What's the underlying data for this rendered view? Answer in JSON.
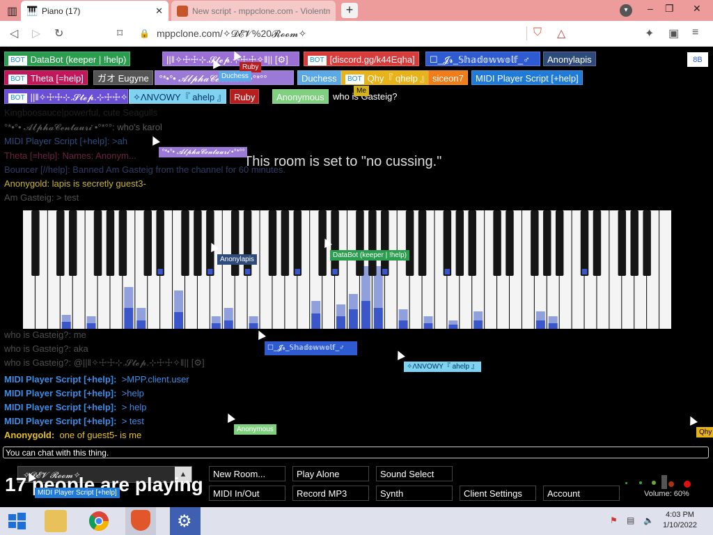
{
  "browser": {
    "tabs": [
      {
        "title": "Piano (17)",
        "active": true
      },
      {
        "title": "New script - mppclone.com - Violentmo",
        "active": false
      }
    ],
    "url": "mppclone.com/✧𝓓𝓔𝓥%20𝓡𝓸𝓸𝓶✧",
    "new_tab": "+",
    "window_controls": [
      "–",
      "❐",
      "✕"
    ]
  },
  "participants": [
    {
      "label": "DataBot (keeper | !help)",
      "bot": true,
      "color": "#2a9d4f"
    },
    {
      "label": "||‖✧☩☩⊹.𝓢𝓽𝓮𝓹.⊹☩☩✧‖|| [⚙]",
      "bot": false,
      "color": "#9a6fd6"
    },
    {
      "label": "[discord.gg/k44Eqha]",
      "bot": true,
      "color": "#d93b3b"
    },
    {
      "label": "☐_𝓙𝓻_𝕊𝕙𝕒𝕕𝕠𝕨𝕨𝕠𝕝𝕗_♂",
      "bot": false,
      "color": "#2e5bd1"
    },
    {
      "label": "Anonylapis",
      "bot": false,
      "color": "#2e4a7a"
    },
    {
      "label": "Theta [=help]",
      "bot": true,
      "color": "#c2185b"
    },
    {
      "label": "ガオ Eugyne",
      "bot": false,
      "color": "#555555"
    },
    {
      "label": "°*•°• 𝓐𝓵𝓹𝓱𝓪𝓒𝓮𝓷𝓽𝓪𝓾𝓻𝓲 •°*°°",
      "bot": false,
      "color": "#9a7ad6"
    },
    {
      "label": "Duchess",
      "bot": false,
      "color": "#5aa9e6"
    },
    {
      "label": "Qhy『 qhelp 』",
      "bot": true,
      "color": "#e8b21a"
    },
    {
      "label": "siceon7",
      "bot": false,
      "color": "#f07d1a"
    },
    {
      "label": "MIDI Player Script [+help]",
      "bot": false,
      "color": "#1f7ad8"
    },
    {
      "label": "||‖✧☩☩⊹.𝓢𝓽𝓮𝓹.⊹☩☩✧‖|| [⚙]",
      "bot": true,
      "color": "#6b4fd6"
    },
    {
      "label": "✧ΛNVOWY『 ahelp 』",
      "bot": false,
      "color": "#7fd3f0"
    },
    {
      "label": "Ruby",
      "bot": false,
      "color": "#b81e1e"
    },
    {
      "label": "Anonymous",
      "bot": false,
      "color": "#7fd07f"
    }
  ],
  "player_count_badge": "8B",
  "typing_text": "who is Gasteig?",
  "notice": "This room is set to \"no cussing.\"",
  "faded_messages": [
    "Kingboosauce|powerful, cute Seagulls",
    "°*•°• 𝓐𝓵𝓹𝓱𝓪𝓒𝓮𝓷𝓽𝓪𝓾𝓻𝓲 •°*°°: who's karol",
    "MIDI Player Script [+help]: >ah",
    "Theta [=help]: Names: Anonym...",
    "Bouncer [//help]: Banned Am Gasteig from the channel for 60 minutes.",
    "Anonygold: lapis is secretly guest3-",
    "Am Gasteig: > test",
    "who is Gasteig?: me",
    "who is Gasteig?: aka",
    "who is Gasteig?: @||‖✧☩☩⊹.𝓢𝓽𝓮𝓹.⊹☩☩✧‖|| [⚙]"
  ],
  "chat": [
    {
      "name": "MIDI Player Script [+help]:",
      "text": ">MPP.client.user",
      "color": "#3b8fe8"
    },
    {
      "name": "MIDI Player Script [+help]:",
      "text": ">help",
      "color": "#3b8fe8"
    },
    {
      "name": "MIDI Player Script [+help]:",
      "text": "> help",
      "color": "#3b8fe8"
    },
    {
      "name": "MIDI Player Script [+help]:",
      "text": "> test",
      "color": "#3b8fe8"
    },
    {
      "name": "Anonygold:",
      "text": "one of guest5- is me",
      "color": "#e8c21a"
    }
  ],
  "chat_placeholder": "You can chat with this thing.",
  "cursors": [
    {
      "label": "Ruby",
      "color": "#b81e1e"
    },
    {
      "label": "Duchess",
      "color": "#5aa9e6"
    },
    {
      "label": "Me",
      "color": "#d4b21a"
    },
    {
      "label": "°*•°• 𝓐𝓵𝓹𝓱𝓪𝓒𝓮𝓷𝓽𝓪𝓾𝓻𝓲 •°*°°",
      "color": "#9a7ad6"
    },
    {
      "label": "Anonylapis",
      "color": "#2e4a7a"
    },
    {
      "label": "DataBot (keeper | !help)",
      "color": "#2a9d4f"
    },
    {
      "label": "☐_𝓙𝓻_𝕊𝕙𝕒𝕕𝕠𝕨𝕨𝕠𝕝𝕗_♂",
      "color": "#2e5bd1"
    },
    {
      "label": "✧ΛNVOWY『 ahelp 』",
      "color": "#7fd3f0"
    },
    {
      "label": "Anonymous",
      "color": "#7fd07f"
    },
    {
      "label": "Qhy",
      "color": "#e8b21a"
    },
    {
      "label": "MIDI Player Script [+help]",
      "color": "#1f7ad8"
    }
  ],
  "bottom": {
    "room": "✧𝓓𝓔𝓥 𝓡𝓸𝓸𝓶✧",
    "playing": "17 people are playing",
    "buttons": [
      "New Room...",
      "Play Alone",
      "Sound Select",
      "MIDI In/Out",
      "Record MP3",
      "Synth",
      "Client Settings",
      "Account"
    ],
    "volume": "Volume: 60%"
  },
  "taskbar": {
    "time": "4:03 PM",
    "date": "1/10/2022"
  },
  "colors": {
    "tabbar": "#ee9b9b",
    "note_blue": "#3a56c8"
  }
}
